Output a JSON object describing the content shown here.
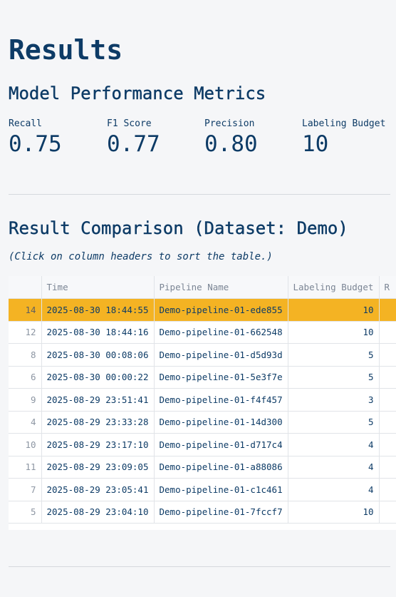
{
  "page": {
    "title": "Results",
    "metrics_heading": "Model Performance Metrics",
    "comparison_heading": "Result Comparison (Dataset: Demo)",
    "hint": "(Click on column headers to sort the table.)"
  },
  "metrics": [
    {
      "label": "Recall",
      "value": "0.75"
    },
    {
      "label": "F1 Score",
      "value": "0.77"
    },
    {
      "label": "Precision",
      "value": "0.80"
    },
    {
      "label": "Labeling Budget",
      "value": "10"
    }
  ],
  "table": {
    "columns": [
      "",
      "Time",
      "Pipeline Name",
      "Labeling Budget",
      "R"
    ],
    "rows": [
      {
        "idx": "14",
        "time": "2025-08-30 18:44:55",
        "name": "Demo-pipeline-01-ede855",
        "budget": "10",
        "highlight": true
      },
      {
        "idx": "12",
        "time": "2025-08-30 18:44:16",
        "name": "Demo-pipeline-01-662548",
        "budget": "10"
      },
      {
        "idx": "8",
        "time": "2025-08-30 00:08:06",
        "name": "Demo-pipeline-01-d5d93d",
        "budget": "5"
      },
      {
        "idx": "6",
        "time": "2025-08-30 00:00:22",
        "name": "Demo-pipeline-01-5e3f7e",
        "budget": "5"
      },
      {
        "idx": "9",
        "time": "2025-08-29 23:51:41",
        "name": "Demo-pipeline-01-f4f457",
        "budget": "3"
      },
      {
        "idx": "4",
        "time": "2025-08-29 23:33:28",
        "name": "Demo-pipeline-01-14d300",
        "budget": "5"
      },
      {
        "idx": "10",
        "time": "2025-08-29 23:17:10",
        "name": "Demo-pipeline-01-d717c4",
        "budget": "4"
      },
      {
        "idx": "11",
        "time": "2025-08-29 23:09:05",
        "name": "Demo-pipeline-01-a88086",
        "budget": "4"
      },
      {
        "idx": "7",
        "time": "2025-08-29 23:05:41",
        "name": "Demo-pipeline-01-c1c461",
        "budget": "4"
      },
      {
        "idx": "5",
        "time": "2025-08-29 23:04:10",
        "name": "Demo-pipeline-01-7fccf7",
        "budget": "10"
      }
    ]
  },
  "colors": {
    "accent": "#0d3b66",
    "highlight": "#f4b323"
  }
}
